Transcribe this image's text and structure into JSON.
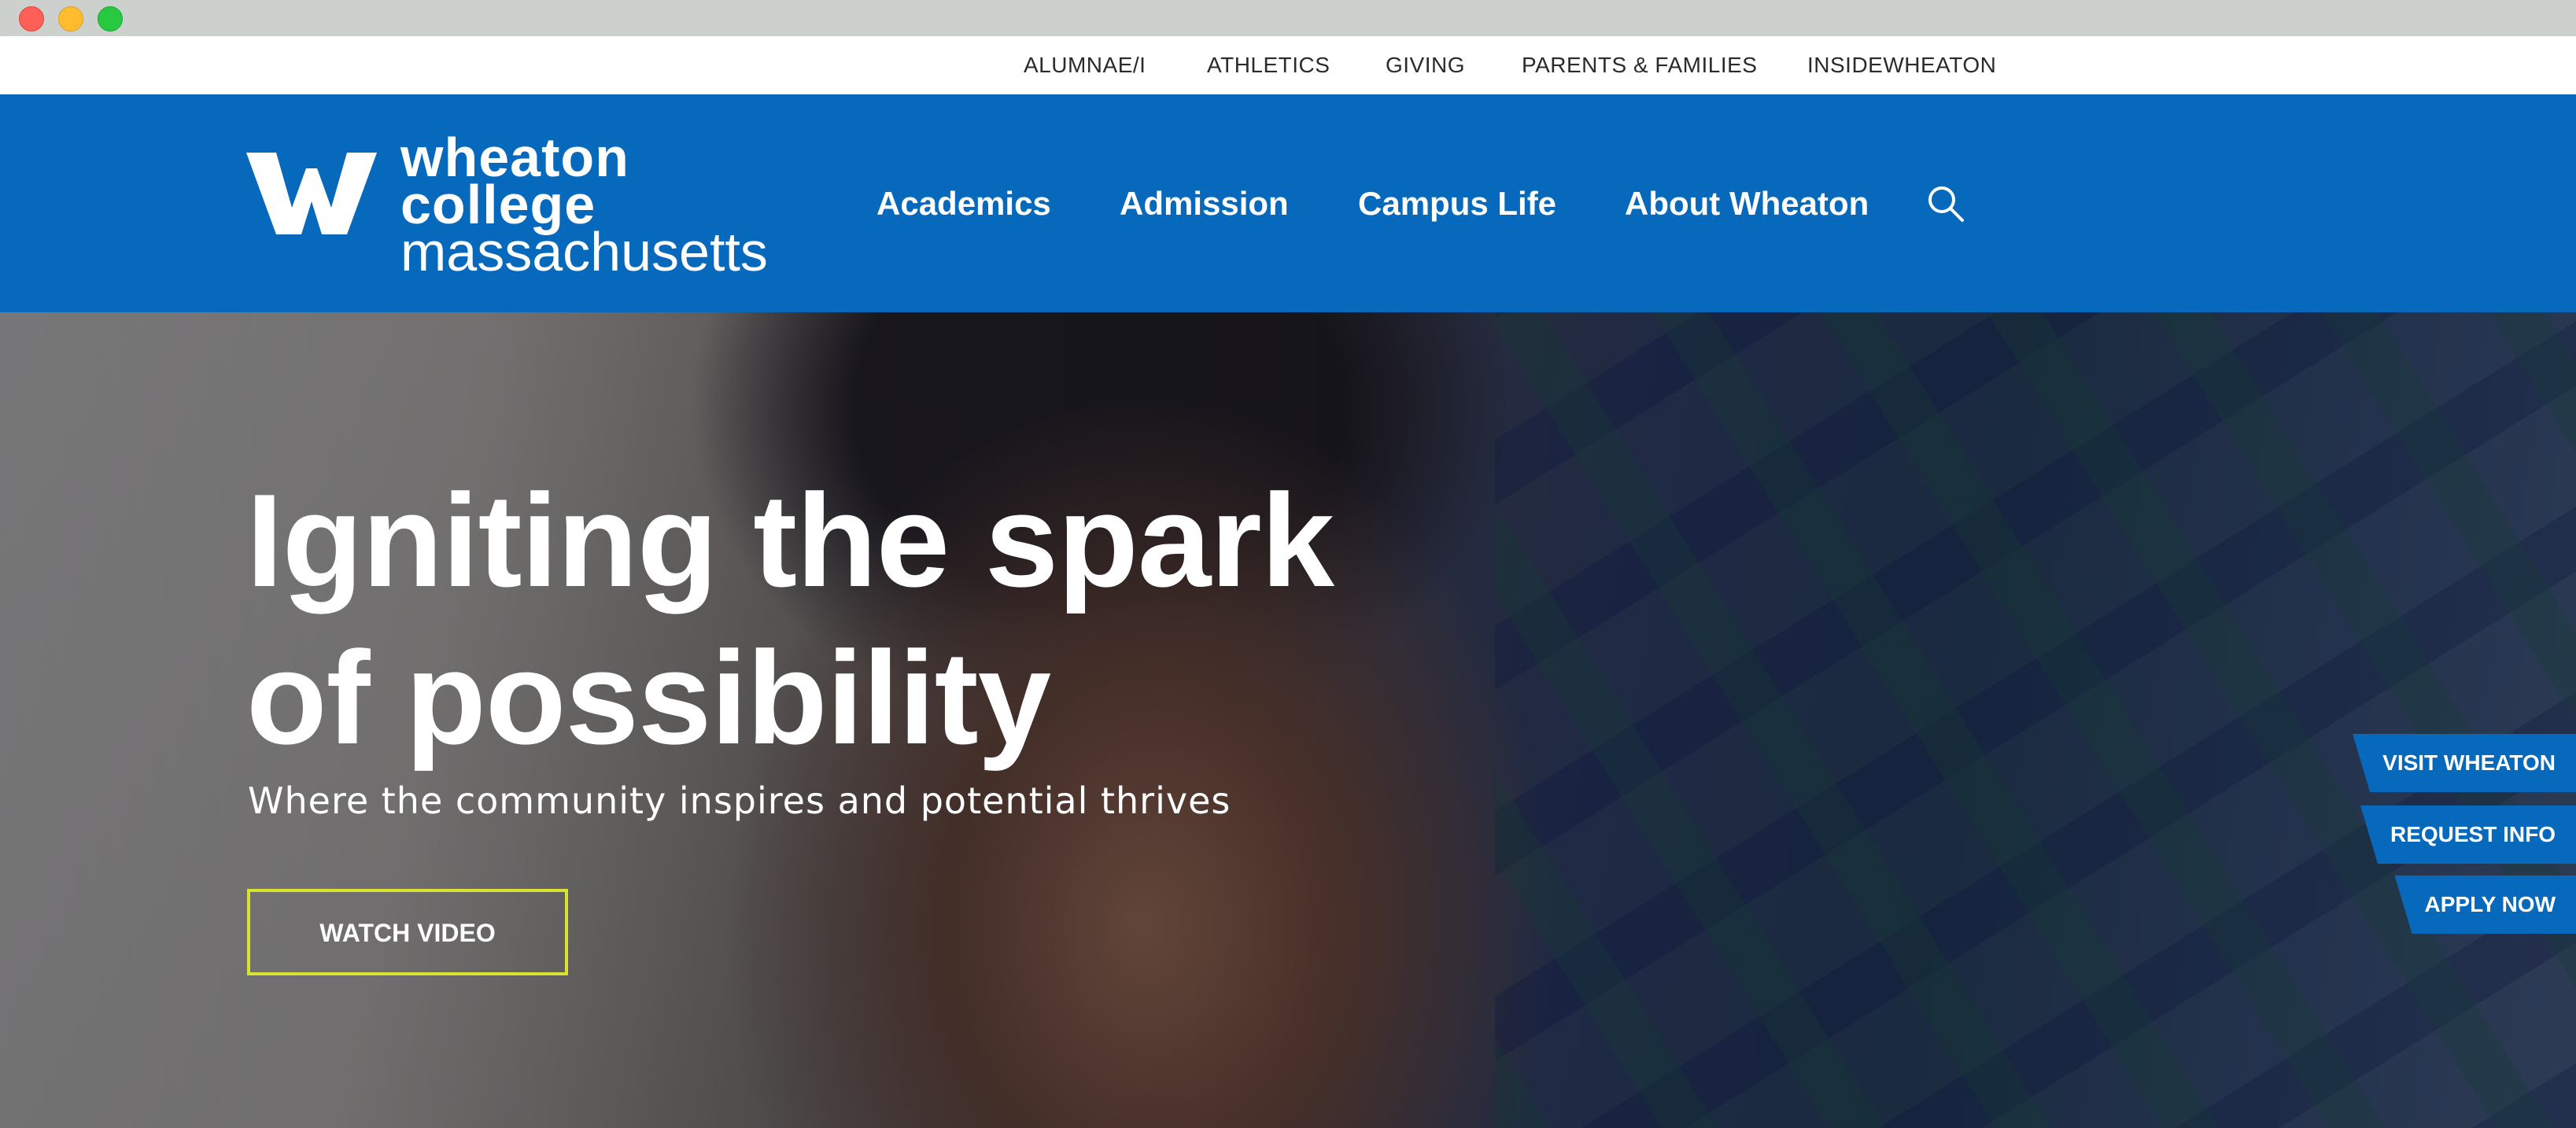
{
  "utility_nav": {
    "items": [
      "ALUMNAE/I",
      "ATHLETICS",
      "GIVING",
      "PARENTS & FAMILIES",
      "INSIDEWHEATON"
    ]
  },
  "header": {
    "logo": {
      "line1": "wheaton",
      "line2": "college",
      "line3": "massachusetts"
    },
    "nav": [
      "Academics",
      "Admission",
      "Campus Life",
      "About Wheaton"
    ],
    "search_icon": "search-icon"
  },
  "hero": {
    "title_line1": "Igniting the spark",
    "title_line2": "of possibility",
    "subtitle": "Where the community inspires and potential thrives",
    "watch_button": "WATCH VIDEO"
  },
  "cta_tabs": [
    "VISIT WHEATON",
    "REQUEST INFO",
    "APPLY NOW"
  ],
  "colors": {
    "brand_blue": "#0769bc",
    "button_outline": "#d9e22e",
    "utility_bg": "#ffffff",
    "titlebar_bg": "#ccd1ce"
  }
}
